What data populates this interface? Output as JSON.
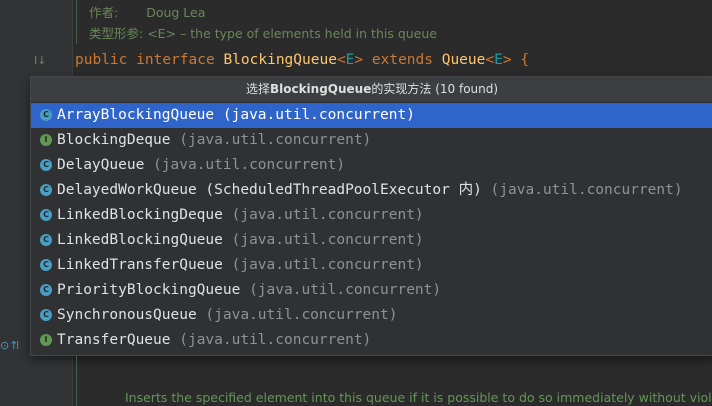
{
  "doc": {
    "author_label": "作者:",
    "author_value": "Doug Lea",
    "typeparam_label": "类型形参:",
    "typeparam_value": "<E> – the type of elements held in this queue"
  },
  "code": {
    "kw_public": "public",
    "kw_interface": "interface",
    "name": "BlockingQueue",
    "tparam_open": "<",
    "tparam": "E",
    "tparam_close": ">",
    "kw_extends": "extends",
    "super": "Queue",
    "super_tparam_open": "<",
    "super_tparam": "E",
    "super_tparam_close": ">",
    "brace": "{"
  },
  "popup": {
    "prefix": "选择",
    "subject": "BlockingQueue",
    "suffix": "的实现方法",
    "count": " (10 found)",
    "items": [
      {
        "name": "ArrayBlockingQueue",
        "pkg": "(java.util.concurrent)",
        "kind": "C",
        "selected": true
      },
      {
        "name": "BlockingDeque",
        "pkg": "(java.util.concurrent)",
        "kind": "I"
      },
      {
        "name": "DelayQueue",
        "pkg": "(java.util.concurrent)",
        "kind": "C"
      },
      {
        "name": "DelayedWorkQueue (ScheduledThreadPoolExecutor 内)",
        "pkg": "(java.util.concurrent)",
        "kind": "C"
      },
      {
        "name": "LinkedBlockingDeque",
        "pkg": "(java.util.concurrent)",
        "kind": "C"
      },
      {
        "name": "LinkedBlockingQueue",
        "pkg": "(java.util.concurrent)",
        "kind": "C"
      },
      {
        "name": "LinkedTransferQueue",
        "pkg": "(java.util.concurrent)",
        "kind": "C"
      },
      {
        "name": "PriorityBlockingQueue",
        "pkg": "(java.util.concurrent)",
        "kind": "C"
      },
      {
        "name": "SynchronousQueue",
        "pkg": "(java.util.concurrent)",
        "kind": "C"
      },
      {
        "name": "TransferQueue",
        "pkg": "(java.util.concurrent)",
        "kind": "I"
      }
    ]
  },
  "bottom_doc": "Inserts the specified element into this queue if it is possible to do so immediately without violati",
  "colors": {
    "selection": "#2f65ca",
    "class_icon": "#4a9ec3",
    "interface_icon": "#629755",
    "keyword": "#cc7832",
    "type_name": "#ffc66d"
  }
}
